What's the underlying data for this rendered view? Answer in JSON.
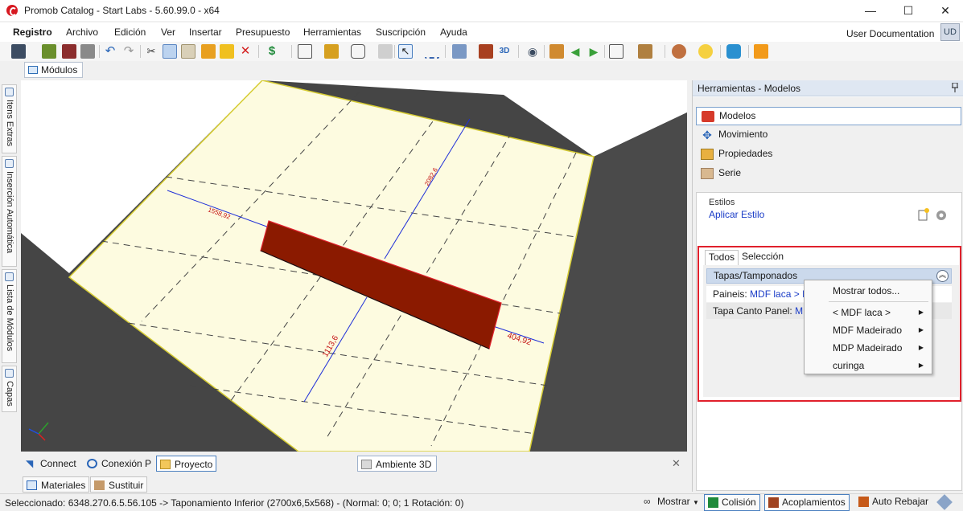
{
  "window": {
    "title": "Promob Catalog - Start Labs - 5.60.99.0 - x64",
    "minimize_glyph": "—",
    "maximize_glyph": "☐",
    "close_glyph": "✕"
  },
  "menubar": {
    "items": [
      "Registro",
      "Archivo",
      "Edición",
      "Ver",
      "Insertar",
      "Presupuesto",
      "Herramientas",
      "Suscripción",
      "Ayuda"
    ],
    "user_label": "User Documentation",
    "user_initials": "UD"
  },
  "toolbar": {
    "icons": [
      "save-icon",
      "print-icon",
      "print-preview-icon",
      "undo-icon",
      "redo-icon",
      "cut-icon",
      "copy-icon",
      "paste-icon",
      "hammer-icon",
      "paint-icon",
      "delete-icon",
      "budget-icon",
      "layout-icon",
      "group-icon",
      "select-icon",
      "pointer-icon",
      "measure-icon",
      "layers-icon",
      "3d-icon",
      "view-icon",
      "eye-icon",
      "module-icon",
      "arrow-left-icon",
      "arrow-right-icon",
      "door-icon",
      "box-icon",
      "light-icon",
      "chat-icon",
      "user-icon"
    ]
  },
  "doc_tab": {
    "label": "Módulos"
  },
  "left_dock": {
    "tabs": [
      "Itens Extras",
      "Inserción Automática",
      "Lista de Módulos",
      "Capas"
    ]
  },
  "viewport": {
    "dimensions": {
      "top_left": "1558,92",
      "top_center": "2082,6",
      "bottom": "1113,6",
      "right": "404,92"
    }
  },
  "bottom_tabs": {
    "items": [
      "Connect",
      "Conexión P",
      "Proyecto"
    ],
    "center": "Ambiente 3D",
    "close": "✕"
  },
  "bottom_tabs2": {
    "items": [
      "Materiales",
      "Sustituir"
    ]
  },
  "status": {
    "selected_text": "Seleccionado: 6348.270.6.5.56.105 -> Taponamiento Inferior (2700x6,5x568) - (Normal: 0; 0; 1 Rotación: 0)",
    "mostrar": "Mostrar",
    "colision": "Colisión",
    "acoplamientos": "Acoplamientos",
    "auto_rebajar": "Auto Rebajar"
  },
  "right_panel": {
    "title": "Herramientas - Modelos",
    "nav": [
      "Modelos",
      "Movimiento",
      "Propiedades",
      "Serie"
    ],
    "estilos_label": "Estilos",
    "aplicar_estilo": "Aplicar Estilo",
    "tabs": [
      "Todos",
      "Selección"
    ],
    "group_title": "Tapas/Tamponados",
    "rows": [
      {
        "label": "Paineis:",
        "value": "MDF laca > Marfil"
      },
      {
        "label": "Tapa Canto Panel:",
        "value": "MD"
      }
    ]
  },
  "context_menu": {
    "items": [
      "Mostrar todos...",
      "< MDF laca >",
      "MDF Madeirado",
      "MDP Madeirado",
      "curinga"
    ]
  },
  "colors": {
    "accent_red": "#e0202c",
    "link_blue": "#1a3cc7",
    "floor": "#fdfbe0",
    "panel_fill": "#8b1a00"
  }
}
